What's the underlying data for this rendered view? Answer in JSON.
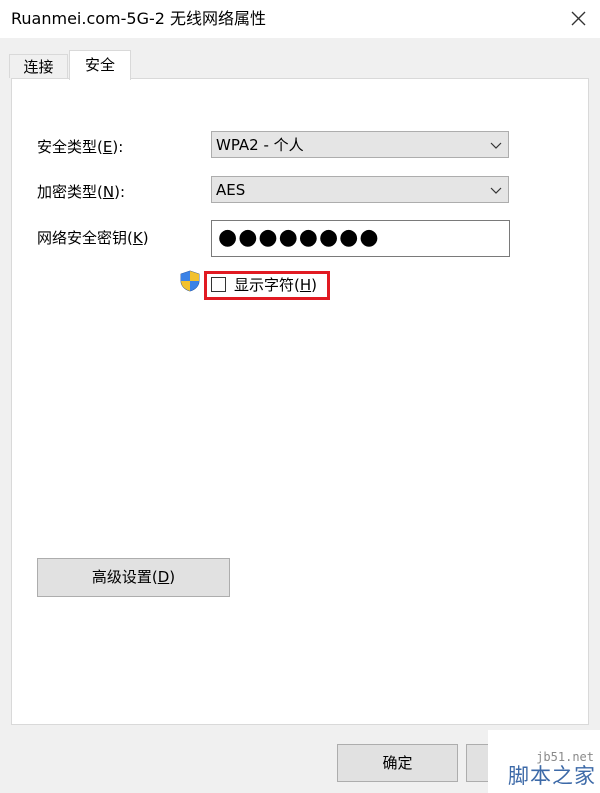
{
  "window": {
    "title": "Ruanmei.com-5G-2 无线网络属性",
    "close_icon": "close-icon"
  },
  "tabs": [
    {
      "label": "连接",
      "active": false
    },
    {
      "label": "安全",
      "active": true
    }
  ],
  "security_type": {
    "label_main": "安全类型(",
    "label_accel": "E",
    "label_end": "):",
    "value": "WPA2 - 个人"
  },
  "encryption_type": {
    "label_main": "加密类型(",
    "label_accel": "N",
    "label_end": "):",
    "value": "AES"
  },
  "network_key": {
    "label_main": "网络安全密钥(",
    "label_accel": "K",
    "label_end": ")",
    "value": "●●●●●●●●"
  },
  "show_chars": {
    "label_main": "显示字符(",
    "label_accel": "H",
    "label_end": ")",
    "checked": false
  },
  "advanced_button": {
    "label_main": "高级设置(",
    "label_accel": "D",
    "label_end": ")"
  },
  "ok_button": {
    "label": "确定"
  },
  "watermark": {
    "domain": "jb51.net",
    "name": "脚本之家"
  },
  "colors": {
    "highlight": "#e11a22",
    "watermark_blue": "#3d6aa8"
  }
}
